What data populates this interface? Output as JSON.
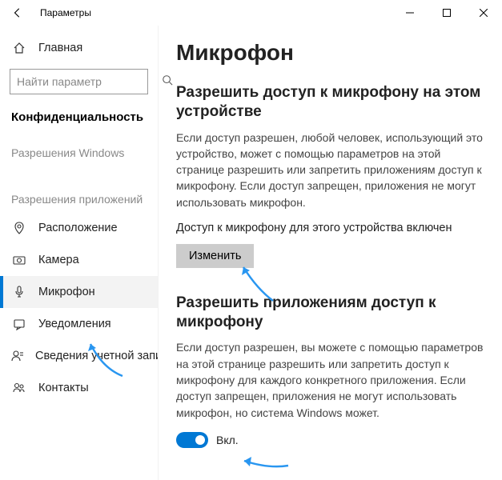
{
  "window": {
    "title": "Параметры"
  },
  "sidebar": {
    "home": "Главная",
    "searchPlaceholder": "Найти параметр",
    "category": "Конфиденциальность",
    "group1": "Разрешения Windows",
    "group2": "Разрешения приложений",
    "items": {
      "location": "Расположение",
      "camera": "Камера",
      "microphone": "Микрофон",
      "notifications": "Уведомления",
      "accountInfo": "Сведения учетной записи",
      "contacts": "Контакты"
    }
  },
  "main": {
    "pageTitle": "Микрофон",
    "section1": {
      "heading": "Разрешить доступ к микрофону на этом устройстве",
      "body": "Если доступ разрешен, любой человек, использующий это устройство, может с помощью параметров на этой странице разрешить или запретить приложениям доступ к микрофону. Если доступ запрещен, приложения не могут использовать микрофон.",
      "status": "Доступ к микрофону для этого устройства включен",
      "button": "Изменить"
    },
    "section2": {
      "heading": "Разрешить приложениям доступ к микрофону",
      "body": "Если доступ разрешен, вы можете с помощью параметров на этой странице разрешить или запретить доступ к микрофону для каждого конкретного приложения. Если доступ запрещен, приложения не могут использовать микрофон, но система Windows может.",
      "toggleLabel": "Вкл."
    }
  }
}
